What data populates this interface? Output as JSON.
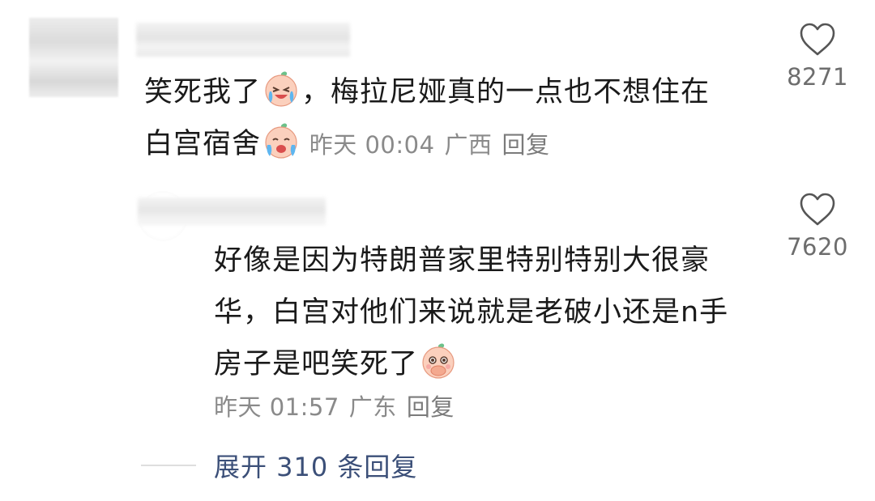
{
  "comment": {
    "text_before_emoji": "笑死我了",
    "text_after_emoji": "，梅拉尼娅真的一点也不想住在",
    "text_line2": "白宫宿舍",
    "time": "昨天 00:04",
    "location": "广西",
    "reply_label": "回复",
    "likes": "8271"
  },
  "reply": {
    "text": "好像是因为特朗普家里特别特别大很豪华，白宫对他们来说就是老破小还是n手房子是吧笑死了",
    "time": "昨天 01:57",
    "location": "广东",
    "reply_label": "回复",
    "likes": "7620"
  },
  "expand": {
    "label": "展开 310 条回复"
  },
  "icons": {
    "like": "heart-outline-icon",
    "emoji_cry": "crying-laugh-emoji-icon",
    "emoji_shy": "covering-mouth-emoji-icon"
  },
  "colors": {
    "text": "#1a1a1a",
    "meta": "#8a8a8a",
    "link": "#3b4f78"
  }
}
